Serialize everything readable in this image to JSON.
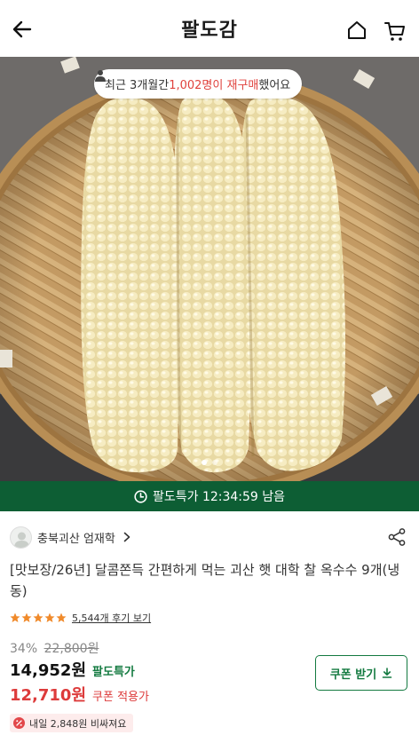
{
  "header": {
    "title": "팔도감",
    "back_icon": "arrow-left-icon",
    "home_icon": "home-icon",
    "cart_icon": "cart-icon"
  },
  "hero": {
    "repurchase": {
      "prefix": "최근 3개월간 ",
      "highlight": "1,002명이 재구매",
      "suffix": " 했어요",
      "highlight_color": "#e0423d"
    },
    "slide_count": 2,
    "active_slide": 1
  },
  "deal": {
    "text": "팔도특가 12:34:59 남음",
    "background": "#0d5e34"
  },
  "seller": {
    "name": "충북괴산 엄재학"
  },
  "product": {
    "title": "[맛보장/26년] 달콤쫀득 간편하게 먹는 괴산 햇 대학 찰 옥수수 9개(냉동)"
  },
  "rating": {
    "stars": 5,
    "review_text": "5,544개 후기 보기"
  },
  "pricing": {
    "discount": "34%",
    "original_price": "22,800원",
    "price": "14,952원",
    "price_tag": "팔도특가",
    "coupon_price": "12,710원",
    "coupon_tag": "쿠폰 적용가",
    "coupon_button": "쿠폰 받기",
    "accent_color": "#137a40",
    "coupon_color": "#dd3b3b"
  },
  "tomorrow": {
    "text": "내일 2,848원 비싸져요"
  }
}
